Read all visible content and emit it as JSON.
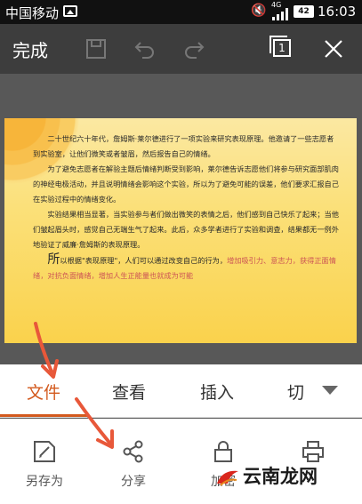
{
  "status_bar": {
    "carrier": "中国移动",
    "network": "4G",
    "battery": "42",
    "time": "16:03"
  },
  "toolbar": {
    "done_label": "完成",
    "page_count": "1",
    "icons": [
      "save-icon",
      "undo-icon",
      "redo-icon",
      "page-count-icon",
      "close-icon"
    ]
  },
  "document": {
    "paragraphs": [
      "二十世纪六十年代，詹姆斯·莱尔德进行了一项实验来研究表现原理。他邀请了一些志愿者到实验室，让他们微笑或者皱眉，然后报告自己的情绪。",
      "为了避免志愿者在解验主题后情绪判断受到影响，莱尔德告诉志愿他们将参与研究面部肌肉的神经电极活动，并且说明情绪会影响这个实验，所以为了避免可能的误差，他们要求汇报自己在实验过程中的情绪变化。",
      "实验结果相当显著，当实验参与者们做出微笑的表情之后，他们感到自己快乐了起来；当他们皱起眉头时，感觉自己无端生气了起来。此后，众多学者进行了实验和调查，结果都无一例外地验证了威廉·詹姆斯的表现原理。"
    ],
    "last_drop_cap": "所",
    "last_normal": "以根据\"表现原理\"，人们可以通过改变自己的行为，",
    "last_highlight": "增加吸引力、意志力，获得正面情绪，对抗负面情绪，增加人生正能量也就成为可能"
  },
  "tabs": [
    {
      "label": "文件",
      "active": true
    },
    {
      "label": "查看",
      "active": false
    },
    {
      "label": "插入",
      "active": false
    },
    {
      "label": "切",
      "active": false
    }
  ],
  "actions": [
    {
      "label": "另存为",
      "icon": "save-as-icon"
    },
    {
      "label": "分享",
      "icon": "share-icon"
    },
    {
      "label": "加密",
      "icon": "lock-icon"
    },
    {
      "label": "打印",
      "icon": "print-icon"
    }
  ],
  "watermark": "云南龙网",
  "colors": {
    "accent": "#d35a1e",
    "toolbar_bg": "#3d3d3d",
    "doc_bg": "#fbe079",
    "arrow": "#e8583a"
  }
}
